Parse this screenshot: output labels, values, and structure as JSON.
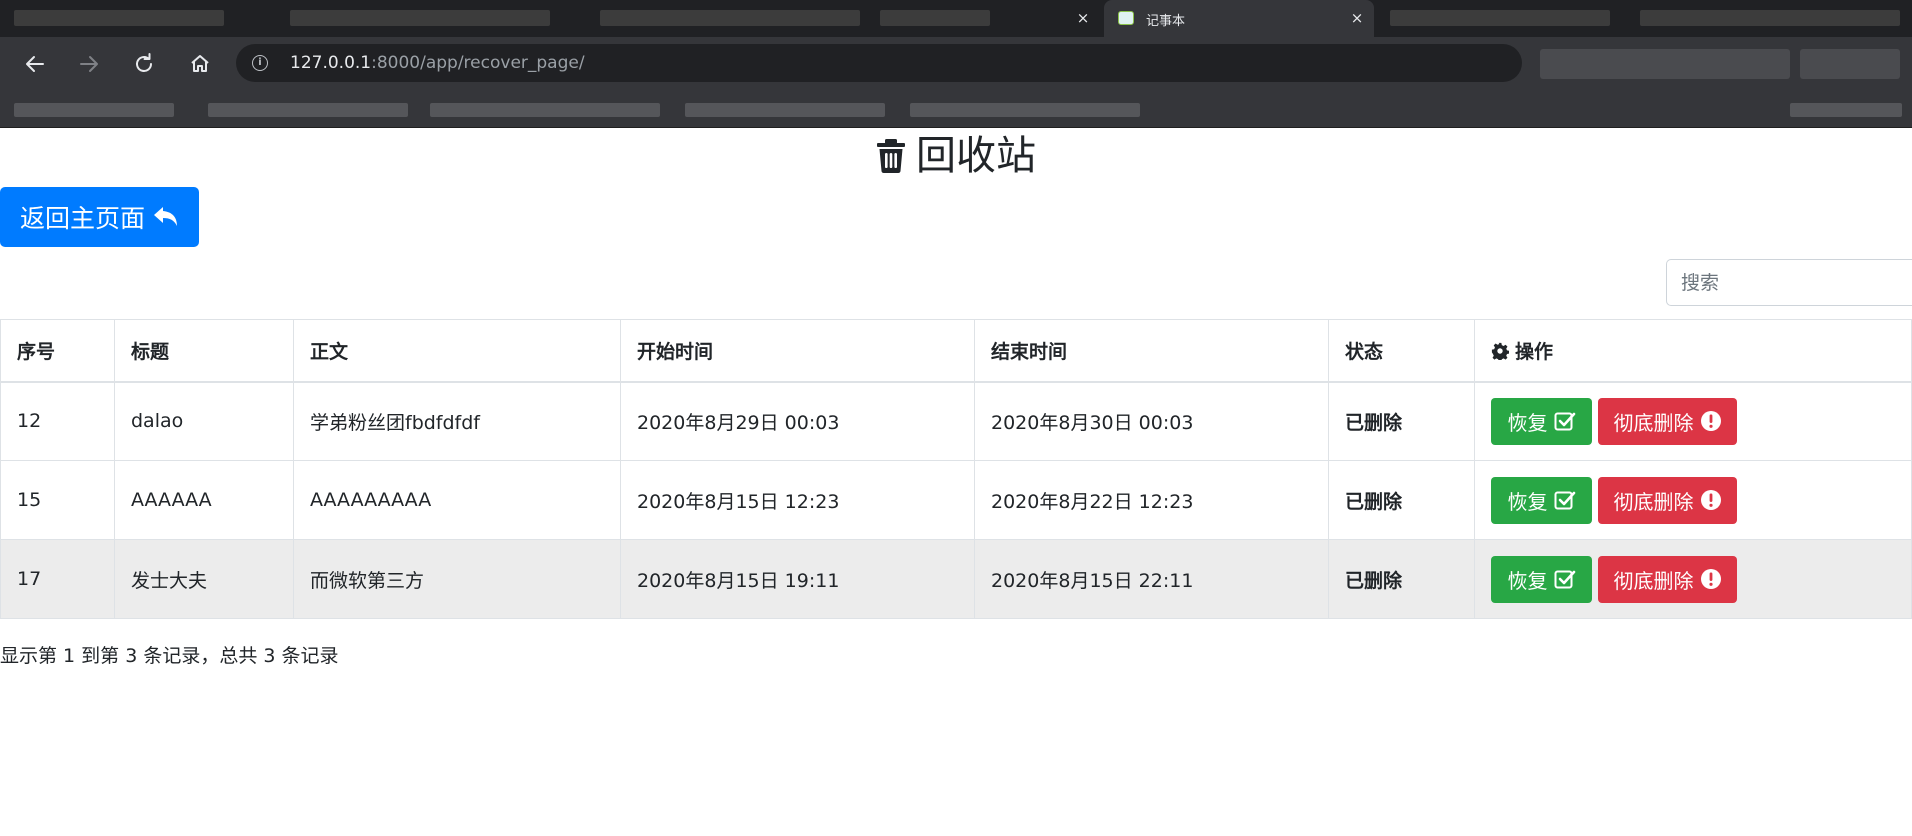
{
  "browser": {
    "active_tab_title": "记事本",
    "tab_close_glyph": "×",
    "url_host": "127.0.0.1",
    "url_path": ":8000/app/recover_page/",
    "info_glyph": "i"
  },
  "page": {
    "title": "回收站",
    "title_icon": "trash-icon",
    "back_button_label": "返回主页面",
    "back_icon": "reply-icon",
    "search_placeholder": "搜索"
  },
  "table": {
    "headers": [
      "序号",
      "标题",
      "正文",
      "开始时间",
      "结束时间",
      "状态",
      "操作"
    ],
    "action_header_icon": "gear-icon",
    "restore_label": "恢复",
    "restore_icon": "check-square-icon",
    "delete_label": "彻底删除",
    "delete_icon": "exclamation-circle-icon",
    "status_color": "#e3000b",
    "rows": [
      {
        "id": "12",
        "title": "dalao",
        "body": "学弟粉丝团fbdfdfdf",
        "start": "2020年8月29日 00:03",
        "end": "2020年8月30日 00:03",
        "status": "已删除"
      },
      {
        "id": "15",
        "title": "AAAAAA",
        "body": "AAAAAAAAA",
        "start": "2020年8月15日 12:23",
        "end": "2020年8月22日 12:23",
        "status": "已删除"
      },
      {
        "id": "17",
        "title": "发士大夫",
        "body": "而微软第三方",
        "start": "2020年8月15日 19:11",
        "end": "2020年8月15日 22:11",
        "status": "已删除"
      }
    ]
  },
  "pagination_info": "显示第 1 到第 3 条记录，总共 3 条记录",
  "colors": {
    "primary": "#007bff",
    "success": "#28a745",
    "danger": "#dc3545"
  }
}
